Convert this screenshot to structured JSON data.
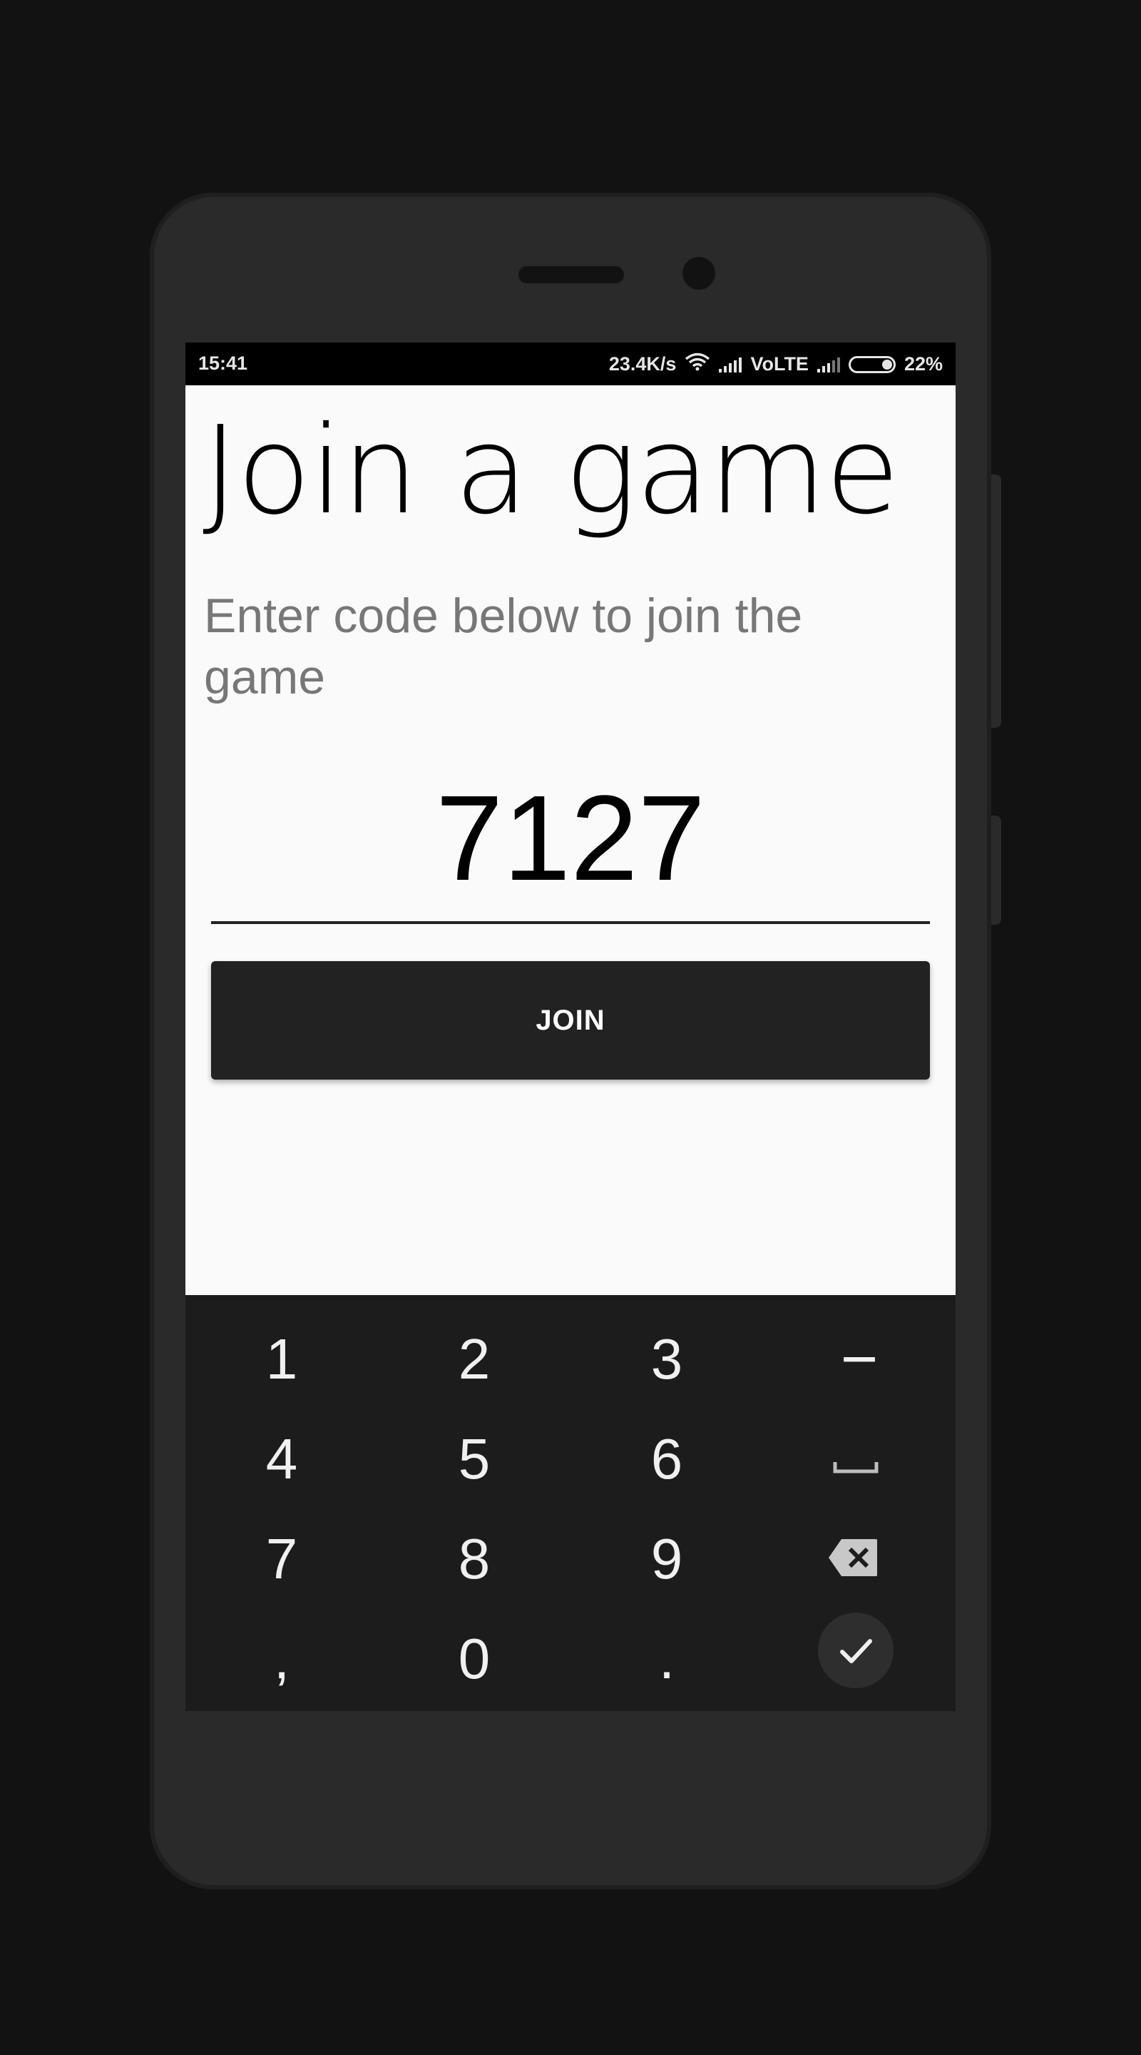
{
  "status_bar": {
    "time": "15:41",
    "net_speed": "23.4K/s",
    "carrier": "VoLTE",
    "battery": "22%",
    "battery_level": 0.22,
    "icons": [
      "wifi-icon",
      "signal-icon",
      "signal-icon",
      "battery-icon"
    ]
  },
  "screen": {
    "title": "Join a game",
    "subtitle": "Enter code below to join the game",
    "code_value": "7127",
    "join_label": "JOIN"
  },
  "keyboard": {
    "rows": [
      [
        "1",
        "2",
        "3",
        "−"
      ],
      [
        "4",
        "5",
        "6",
        "space"
      ],
      [
        "7",
        "8",
        "9",
        "backspace"
      ],
      [
        ",",
        "0",
        ".",
        "done"
      ]
    ],
    "key_1": "1",
    "key_2": "2",
    "key_3": "3",
    "key_minus": "−",
    "key_4": "4",
    "key_5": "5",
    "key_6": "6",
    "key_7": "7",
    "key_8": "8",
    "key_9": "9",
    "key_comma": ",",
    "key_0": "0",
    "key_period": "."
  }
}
